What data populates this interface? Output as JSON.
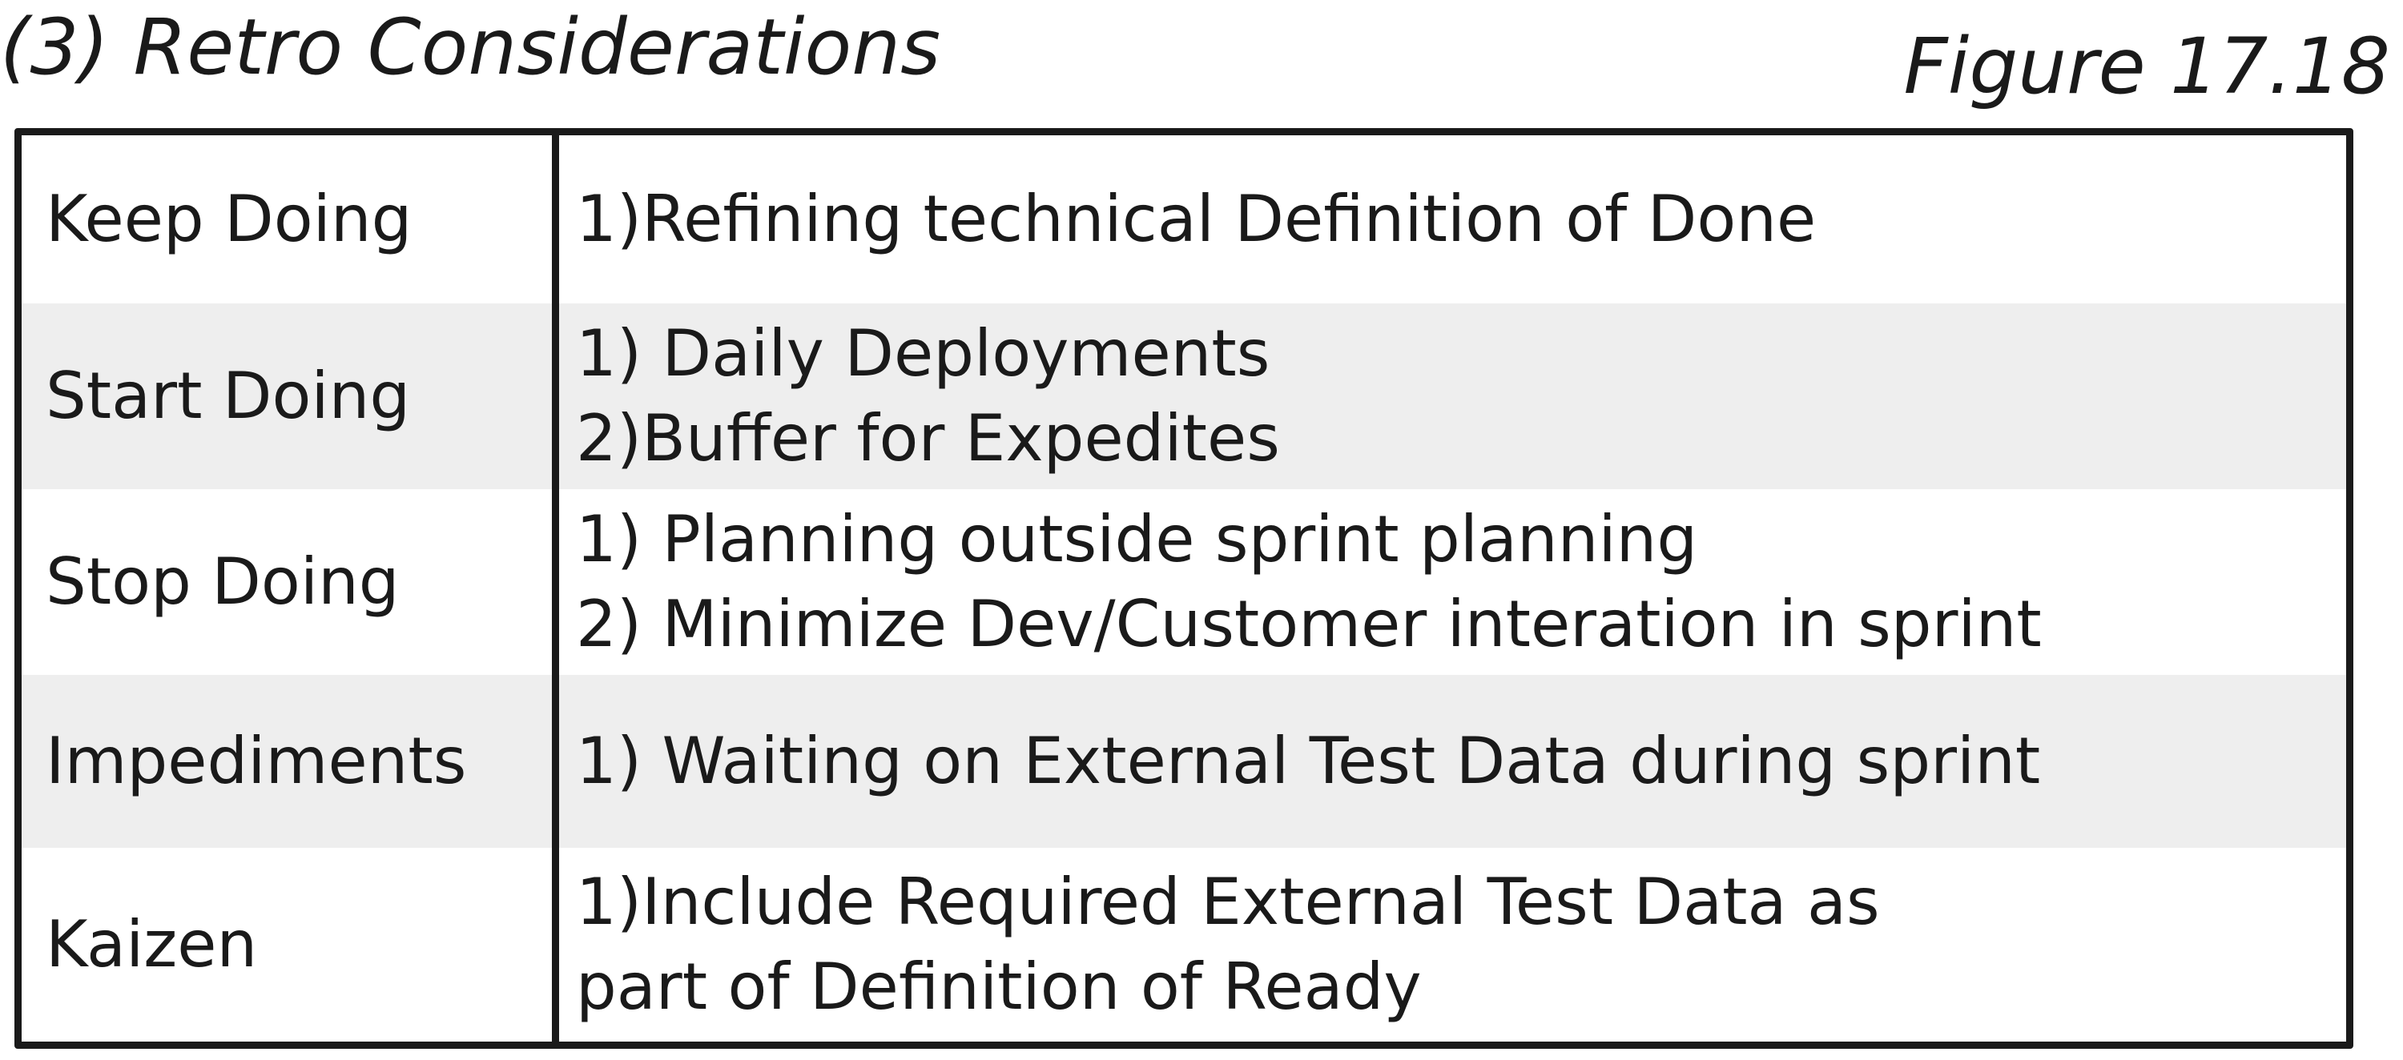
{
  "title": "(3) Retro Considerations",
  "figure_label": "Figure 17.18",
  "rows": [
    {
      "label": "Keep Doing",
      "items": [
        "1)Refining technical Definition of Done"
      ]
    },
    {
      "label": "Start Doing",
      "items": [
        "1) Daily Deployments",
        "2)Buffer for Expedites"
      ]
    },
    {
      "label": "Stop Doing",
      "items": [
        "1) Planning outside sprint planning",
        "2) Minimize Dev/Customer interation in sprint"
      ]
    },
    {
      "label": "Impediments",
      "items": [
        "1) Waiting on External Test Data during sprint"
      ]
    },
    {
      "label": "Kaizen",
      "items": [
        "1)Include Required External Test Data as",
        "part of Definition of Ready"
      ]
    }
  ],
  "colors": {
    "border": "#1a1a1a",
    "row_shade": "#eeeeee",
    "background": "#ffffff"
  }
}
